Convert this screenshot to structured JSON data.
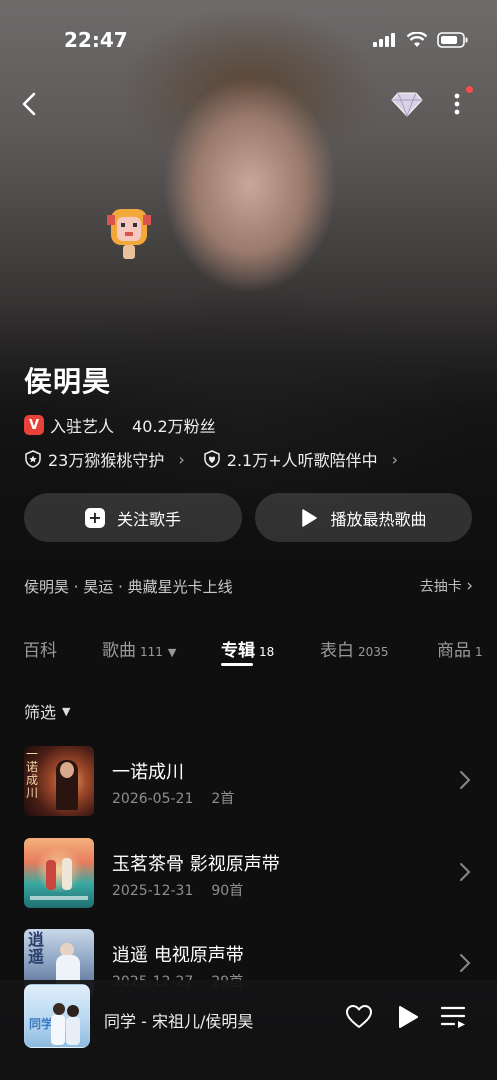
{
  "status": {
    "time": "22:47"
  },
  "artist": {
    "name": "侯明昊",
    "verified_badge": "V",
    "verified_label": "入驻艺人",
    "fans": "40.2万粉丝",
    "guardians": "23万猕猴桃守护",
    "listeners": "2.1万+人听歌陪伴中"
  },
  "actions": {
    "follow": "关注歌手",
    "play_hot": "播放最热歌曲"
  },
  "banner": {
    "text": "侯明昊 · 昊运 · 典藏星光卡上线",
    "action": "去抽卡"
  },
  "tabs": [
    {
      "label": "百科",
      "count": ""
    },
    {
      "label": "歌曲",
      "count": "111"
    },
    {
      "label": "专辑",
      "count": "18"
    },
    {
      "label": "表白",
      "count": "2035"
    },
    {
      "label": "商品",
      "count": "1"
    }
  ],
  "filter": {
    "label": "筛选"
  },
  "albums": [
    {
      "title": "一诺成川",
      "date": "2026-05-21",
      "tracks": "2首",
      "cover_text": "一诺成川"
    },
    {
      "title": "玉茗茶骨 影视原声带",
      "date": "2025-12-31",
      "tracks": "90首",
      "cover_text": ""
    },
    {
      "title": "逍遥 电视原声带",
      "date": "2025-12-27",
      "tracks": "29首",
      "cover_text": "逍遥"
    }
  ],
  "player": {
    "track": "同学 - 宋祖儿/侯明昊",
    "cover_text": "同学"
  },
  "colors": {
    "accent": "#e8423a",
    "notification_dot": "#ff4b4b",
    "background": "#0f0f10"
  },
  "icons": [
    "back-icon",
    "diamond-icon",
    "more-icon",
    "star-shield-icon",
    "heart-shield-icon",
    "plus-icon",
    "play-icon",
    "chevron-right-icon",
    "caret-down-icon",
    "heart-icon",
    "queue-icon"
  ]
}
